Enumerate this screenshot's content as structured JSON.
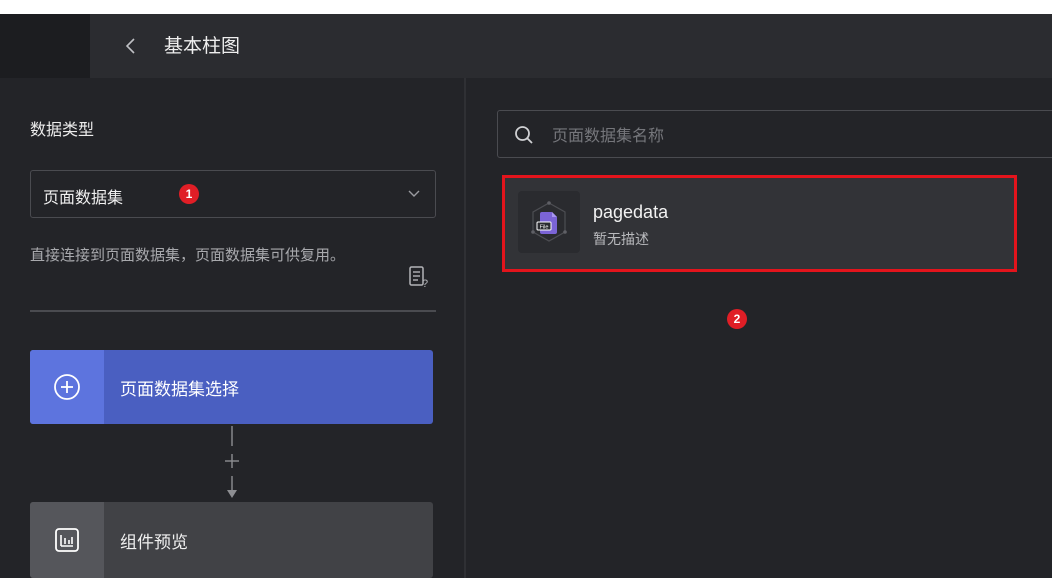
{
  "header": {
    "title": "基本柱图"
  },
  "left": {
    "section_title": "数据类型",
    "select": {
      "value": "页面数据集",
      "step": "1"
    },
    "description": "直接连接到页面数据集，页面数据集可供复用。",
    "select_button_label": "页面数据集选择",
    "preview_button_label": "组件预览"
  },
  "right": {
    "search": {
      "placeholder": "页面数据集名称",
      "value": ""
    },
    "dataset": {
      "name": "pagedata",
      "description": "暂无描述"
    },
    "step": "2"
  },
  "colors": {
    "accent": "#4a5fc1",
    "annotation": "#e3141c"
  }
}
